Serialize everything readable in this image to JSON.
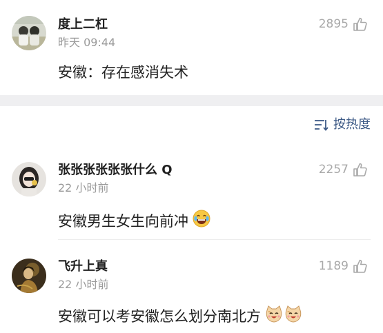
{
  "comments": [
    {
      "username": "度上二杠",
      "time": "昨天 09:44",
      "likes": "2895",
      "text": "安徽：存在感消失术",
      "avatar_icon": "avatar-two-figures-icon"
    },
    {
      "username": "张张张张张张什么 Q",
      "time": "22 小时前",
      "likes": "2257",
      "text": "安徽男生女生向前冲",
      "emoji": "laughing-tears-emoji"
    },
    {
      "username": "飞升上真",
      "time": "22 小时前",
      "likes": "1189",
      "text": "安徽可以考安徽怎么划分南北方",
      "emoji": "cat-face-emoji"
    }
  ],
  "sort": {
    "label": "按热度",
    "icon": "sort-lines-icon"
  },
  "colors": {
    "accent": "#3d5a86",
    "muted": "#9a9a9a",
    "band": "#efeff1"
  }
}
